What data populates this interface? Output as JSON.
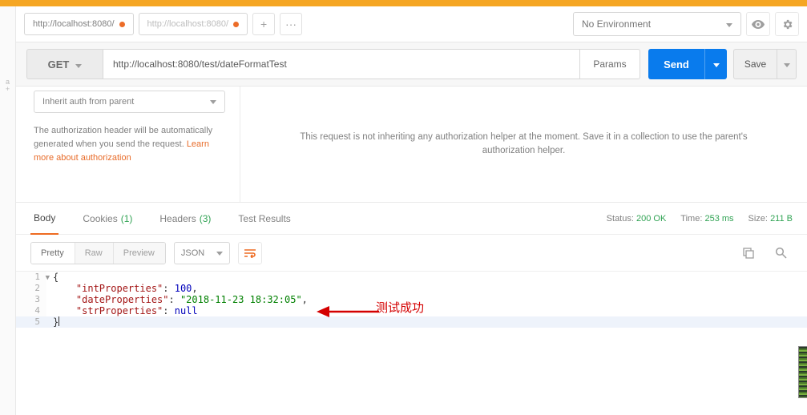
{
  "tabs": {
    "active": {
      "label": "http://localhost:8080/"
    },
    "inactive": {
      "label": "http://localhost:8080/"
    },
    "add": "+",
    "more": "···"
  },
  "env": {
    "label": "No Environment"
  },
  "request": {
    "method": "GET",
    "url": "http://localhost:8080/test/dateFormatTest",
    "params_label": "Params",
    "send_label": "Send",
    "save_label": "Save"
  },
  "auth": {
    "select_label": "Inherit auth from parent",
    "desc_pre": "The authorization header will be automatically generated when you send the request. ",
    "desc_link": "Learn more about authorization",
    "right_msg": "This request is not inheriting any authorization helper at the moment. Save it in a collection to use the parent's authorization helper."
  },
  "resp_tabs": {
    "body": "Body",
    "cookies": "Cookies",
    "cookies_count": "(1)",
    "headers": "Headers",
    "headers_count": "(3)",
    "tests": "Test Results"
  },
  "resp_stats": {
    "status_label": "Status:",
    "status_value": "200 OK",
    "time_label": "Time:",
    "time_value": "253 ms",
    "size_label": "Size:",
    "size_value": "211 B"
  },
  "fmt": {
    "pretty": "Pretty",
    "raw": "Raw",
    "preview": "Preview",
    "type": "JSON"
  },
  "code": {
    "l1": "1",
    "l2": "2",
    "l3": "3",
    "l4": "4",
    "l5": "5",
    "k_int": "\"intProperties\"",
    "v_int": "100",
    "k_date": "\"dateProperties\"",
    "v_date": "\"2018-11-23 18:32:05\"",
    "k_str": "\"strProperties\"",
    "v_null": "null"
  },
  "annotation": "测试成功"
}
